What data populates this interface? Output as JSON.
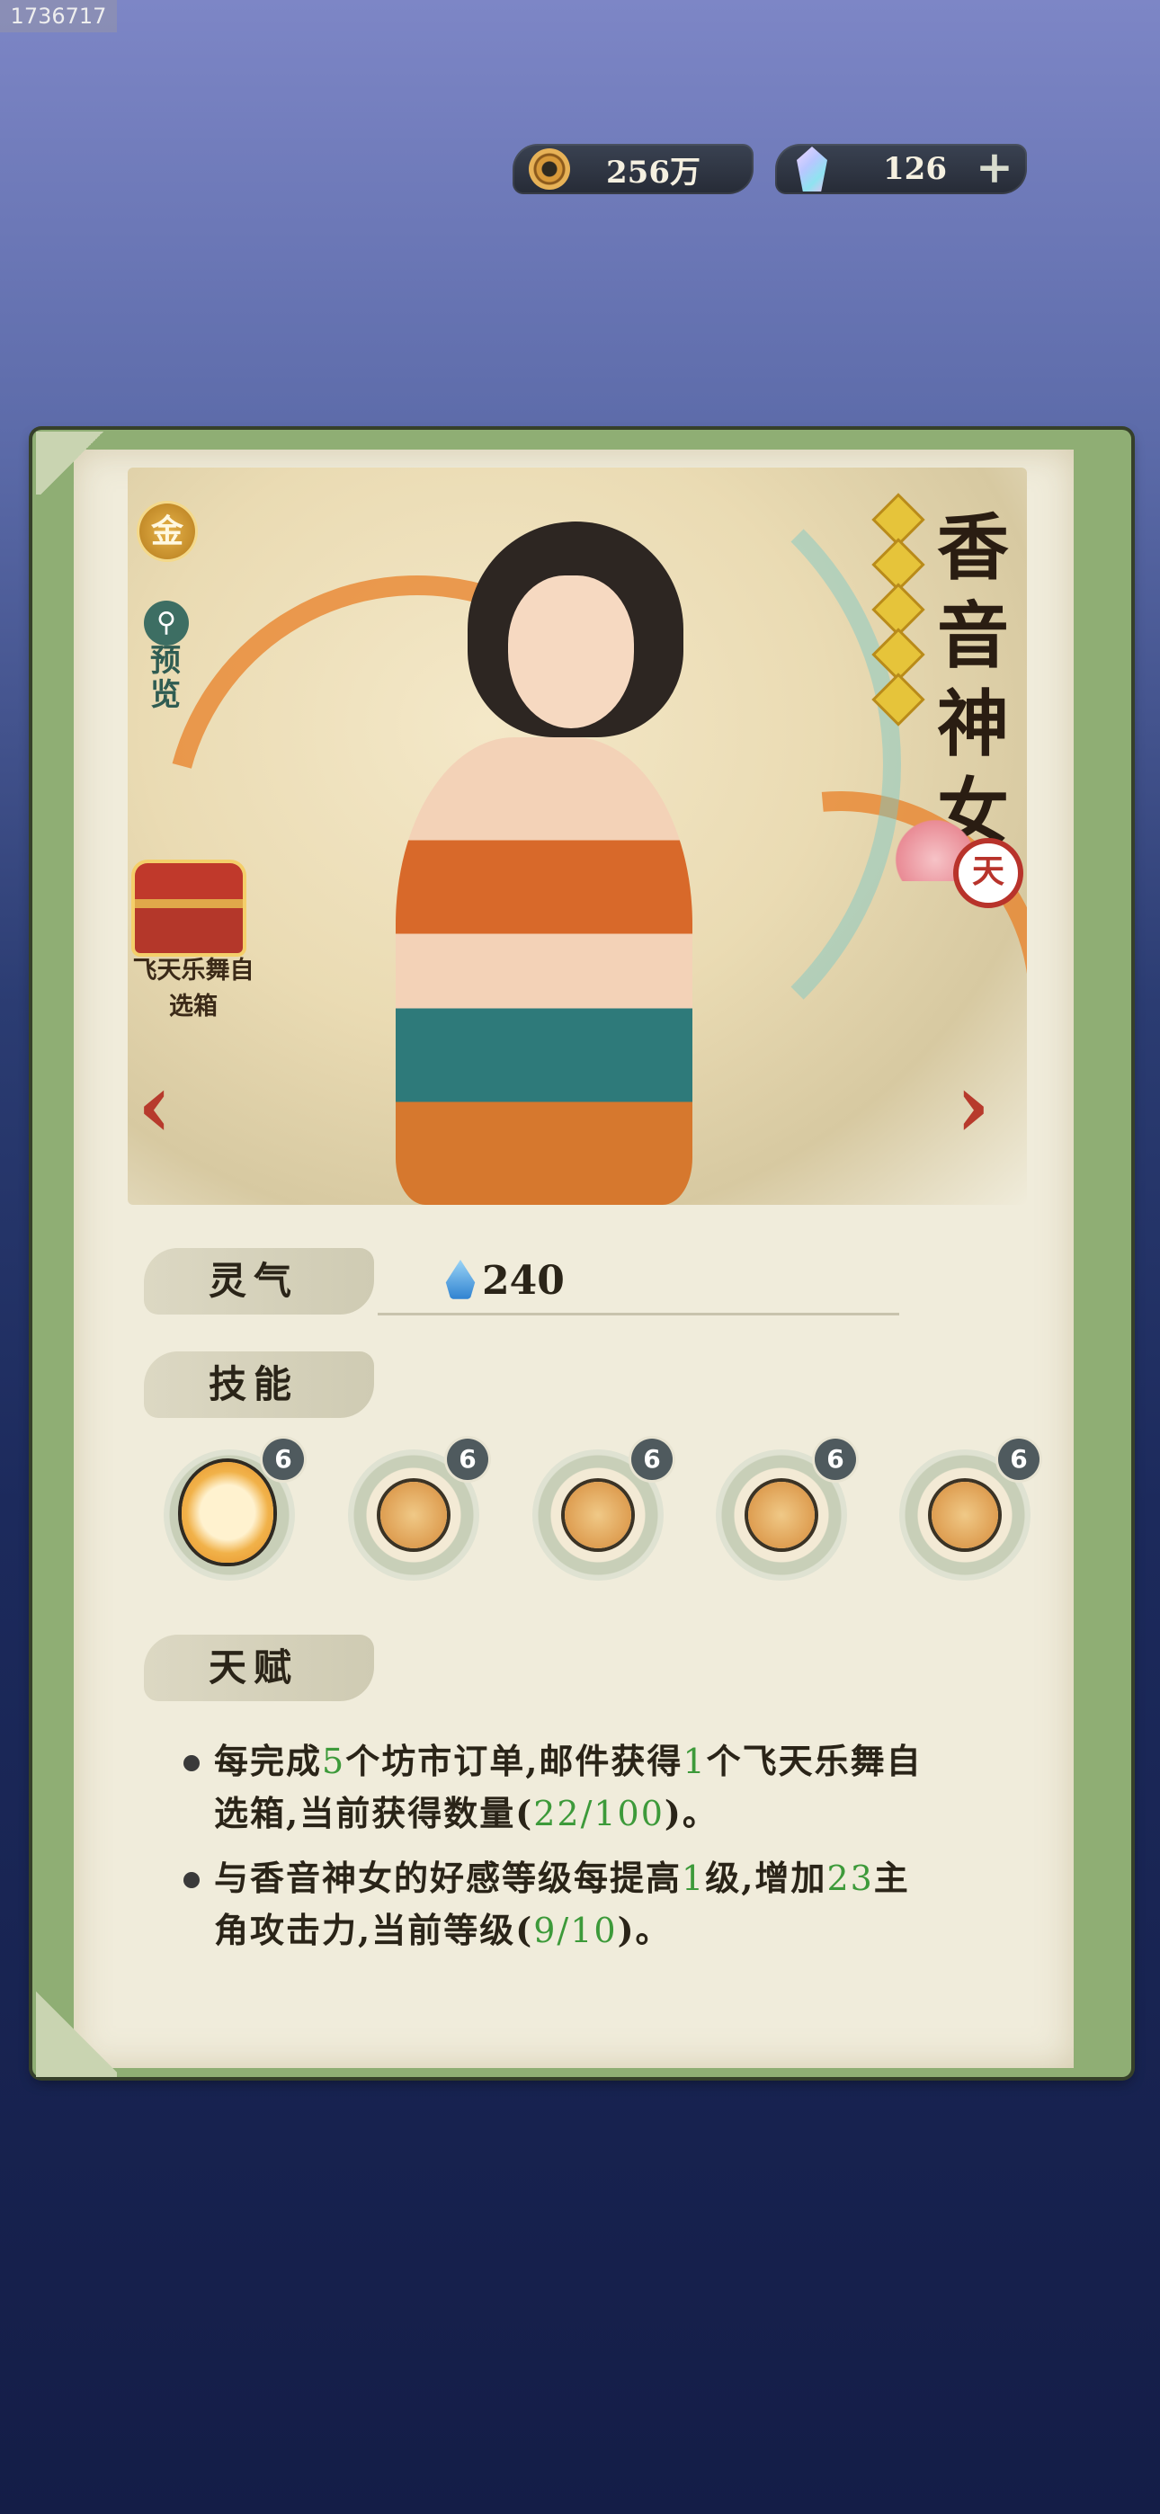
{
  "watermark": "1736717",
  "currency": {
    "coins": "256万",
    "gems": "126",
    "coin_icon": "copper-coin-icon",
    "gem_icon": "crystal-gem-icon",
    "add_icon": "plus-icon"
  },
  "character": {
    "rarity": "金",
    "preview_label": "预览",
    "name": "香音神女",
    "stars": 5,
    "element": "天",
    "chest_label": "飞天乐舞自选箱"
  },
  "stats": {
    "lingqi_label": "灵气",
    "lingqi_value": "240"
  },
  "skills": {
    "label": "技能",
    "items": [
      {
        "level": "6",
        "icon": "character-portrait-icon"
      },
      {
        "level": "6",
        "icon": "pipa-lute-icon"
      },
      {
        "level": "6",
        "icon": "basket-icon"
      },
      {
        "level": "6",
        "icon": "cloud-bun-icon"
      },
      {
        "level": "6",
        "icon": "cat-icon"
      }
    ]
  },
  "talent": {
    "label": "天赋",
    "lines": [
      {
        "p1": "每完成",
        "n1": "5",
        "p2": "个坊市订单,邮件获得",
        "n2": "1",
        "p3": "个飞天乐舞自选箱,当前获得数量(",
        "n3": "22/100",
        "p4": ")。"
      },
      {
        "p1": "与香音神女的好感等级每提高",
        "n1": "1",
        "p2": "级,增加",
        "n2": "23",
        "p3": "主角攻击力,当前等级(",
        "n3": "9/10",
        "p4": ")。"
      }
    ]
  },
  "colors": {
    "highlight_green": "#3d9a3a",
    "nav_arrow_red": "#b73a2c",
    "scroll_green": "#8fae74",
    "paper": "#f0ecdb"
  }
}
